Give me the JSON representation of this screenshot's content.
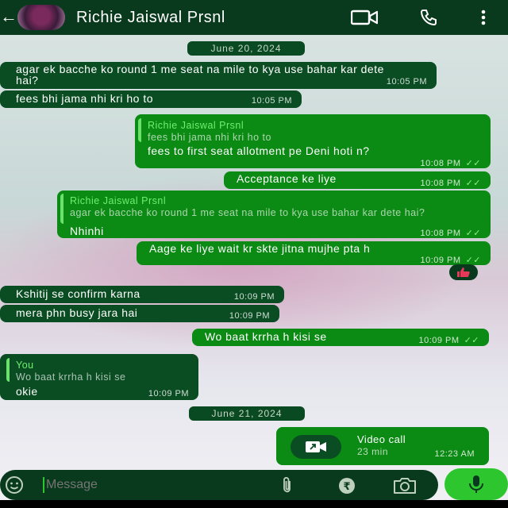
{
  "header": {
    "contact_name": "Richie Jaiswal Prsnl",
    "icons": [
      "back-arrow-icon",
      "video-call-icon",
      "phone-icon",
      "more-options-icon"
    ]
  },
  "dates": [
    "June 20, 2024",
    "June 21, 2024"
  ],
  "messages": [
    {
      "dir": "in",
      "text": "agar ek bacche ko round 1 me seat na mile to kya use bahar kar dete hai?",
      "time": "10:05 PM"
    },
    {
      "dir": "in",
      "text": "fees bhi jama nhi kri ho to",
      "time": "10:05 PM"
    },
    {
      "dir": "out",
      "quote_name": "Richie Jaiswal Prsnl",
      "quote_text": "fees bhi jama nhi kri ho to",
      "text": "fees to first seat allotment pe Deni hoti n?",
      "time": "10:08 PM"
    },
    {
      "dir": "out",
      "text": "Acceptance ke liye",
      "time": "10:08 PM"
    },
    {
      "dir": "out",
      "quote_name": "Richie Jaiswal Prsnl",
      "quote_text": "agar ek bacche ko round 1 me seat na mile to kya use bahar kar dete hai?",
      "text": "Nhinhi",
      "time": "10:08 PM"
    },
    {
      "dir": "out",
      "text": "Aage ke liye wait kr skte jitna mujhe pta h",
      "time": "10:09 PM",
      "reaction": "thumbs-up"
    },
    {
      "dir": "in",
      "text": "Kshitij se confirm karna",
      "time": "10:09 PM"
    },
    {
      "dir": "in",
      "text": "mera phn busy jara hai",
      "time": "10:09 PM"
    },
    {
      "dir": "out",
      "text": "Wo baat krrha h kisi se",
      "time": "10:09 PM"
    },
    {
      "dir": "in",
      "quote_name": "You",
      "quote_text": "Wo baat krrha h kisi se",
      "text": "okie",
      "time": "10:09 PM"
    },
    {
      "dir": "out",
      "type": "video_call",
      "title": "Video call",
      "duration": "23 min",
      "time": "12:23 AM"
    }
  ],
  "composer": {
    "placeholder": "Message",
    "icons": [
      "emoji-icon",
      "attach-icon",
      "payment-icon",
      "camera-icon",
      "mic-icon"
    ]
  },
  "colors": {
    "header": "#0a3a1d",
    "incoming": "#0a4d23",
    "outgoing": "#0b8a14",
    "accent": "#2ec62e"
  }
}
